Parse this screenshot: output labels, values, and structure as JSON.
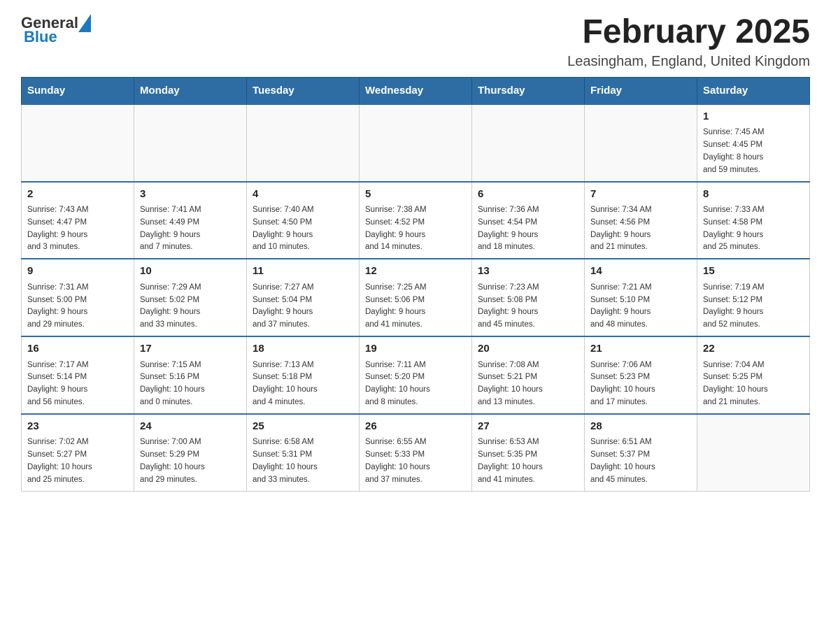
{
  "header": {
    "logo": {
      "general": "General",
      "blue": "Blue"
    },
    "title": "February 2025",
    "subtitle": "Leasingham, England, United Kingdom"
  },
  "calendar": {
    "days_of_week": [
      "Sunday",
      "Monday",
      "Tuesday",
      "Wednesday",
      "Thursday",
      "Friday",
      "Saturday"
    ],
    "weeks": [
      [
        {
          "day": "",
          "info": ""
        },
        {
          "day": "",
          "info": ""
        },
        {
          "day": "",
          "info": ""
        },
        {
          "day": "",
          "info": ""
        },
        {
          "day": "",
          "info": ""
        },
        {
          "day": "",
          "info": ""
        },
        {
          "day": "1",
          "info": "Sunrise: 7:45 AM\nSunset: 4:45 PM\nDaylight: 8 hours\nand 59 minutes."
        }
      ],
      [
        {
          "day": "2",
          "info": "Sunrise: 7:43 AM\nSunset: 4:47 PM\nDaylight: 9 hours\nand 3 minutes."
        },
        {
          "day": "3",
          "info": "Sunrise: 7:41 AM\nSunset: 4:49 PM\nDaylight: 9 hours\nand 7 minutes."
        },
        {
          "day": "4",
          "info": "Sunrise: 7:40 AM\nSunset: 4:50 PM\nDaylight: 9 hours\nand 10 minutes."
        },
        {
          "day": "5",
          "info": "Sunrise: 7:38 AM\nSunset: 4:52 PM\nDaylight: 9 hours\nand 14 minutes."
        },
        {
          "day": "6",
          "info": "Sunrise: 7:36 AM\nSunset: 4:54 PM\nDaylight: 9 hours\nand 18 minutes."
        },
        {
          "day": "7",
          "info": "Sunrise: 7:34 AM\nSunset: 4:56 PM\nDaylight: 9 hours\nand 21 minutes."
        },
        {
          "day": "8",
          "info": "Sunrise: 7:33 AM\nSunset: 4:58 PM\nDaylight: 9 hours\nand 25 minutes."
        }
      ],
      [
        {
          "day": "9",
          "info": "Sunrise: 7:31 AM\nSunset: 5:00 PM\nDaylight: 9 hours\nand 29 minutes."
        },
        {
          "day": "10",
          "info": "Sunrise: 7:29 AM\nSunset: 5:02 PM\nDaylight: 9 hours\nand 33 minutes."
        },
        {
          "day": "11",
          "info": "Sunrise: 7:27 AM\nSunset: 5:04 PM\nDaylight: 9 hours\nand 37 minutes."
        },
        {
          "day": "12",
          "info": "Sunrise: 7:25 AM\nSunset: 5:06 PM\nDaylight: 9 hours\nand 41 minutes."
        },
        {
          "day": "13",
          "info": "Sunrise: 7:23 AM\nSunset: 5:08 PM\nDaylight: 9 hours\nand 45 minutes."
        },
        {
          "day": "14",
          "info": "Sunrise: 7:21 AM\nSunset: 5:10 PM\nDaylight: 9 hours\nand 48 minutes."
        },
        {
          "day": "15",
          "info": "Sunrise: 7:19 AM\nSunset: 5:12 PM\nDaylight: 9 hours\nand 52 minutes."
        }
      ],
      [
        {
          "day": "16",
          "info": "Sunrise: 7:17 AM\nSunset: 5:14 PM\nDaylight: 9 hours\nand 56 minutes."
        },
        {
          "day": "17",
          "info": "Sunrise: 7:15 AM\nSunset: 5:16 PM\nDaylight: 10 hours\nand 0 minutes."
        },
        {
          "day": "18",
          "info": "Sunrise: 7:13 AM\nSunset: 5:18 PM\nDaylight: 10 hours\nand 4 minutes."
        },
        {
          "day": "19",
          "info": "Sunrise: 7:11 AM\nSunset: 5:20 PM\nDaylight: 10 hours\nand 8 minutes."
        },
        {
          "day": "20",
          "info": "Sunrise: 7:08 AM\nSunset: 5:21 PM\nDaylight: 10 hours\nand 13 minutes."
        },
        {
          "day": "21",
          "info": "Sunrise: 7:06 AM\nSunset: 5:23 PM\nDaylight: 10 hours\nand 17 minutes."
        },
        {
          "day": "22",
          "info": "Sunrise: 7:04 AM\nSunset: 5:25 PM\nDaylight: 10 hours\nand 21 minutes."
        }
      ],
      [
        {
          "day": "23",
          "info": "Sunrise: 7:02 AM\nSunset: 5:27 PM\nDaylight: 10 hours\nand 25 minutes."
        },
        {
          "day": "24",
          "info": "Sunrise: 7:00 AM\nSunset: 5:29 PM\nDaylight: 10 hours\nand 29 minutes."
        },
        {
          "day": "25",
          "info": "Sunrise: 6:58 AM\nSunset: 5:31 PM\nDaylight: 10 hours\nand 33 minutes."
        },
        {
          "day": "26",
          "info": "Sunrise: 6:55 AM\nSunset: 5:33 PM\nDaylight: 10 hours\nand 37 minutes."
        },
        {
          "day": "27",
          "info": "Sunrise: 6:53 AM\nSunset: 5:35 PM\nDaylight: 10 hours\nand 41 minutes."
        },
        {
          "day": "28",
          "info": "Sunrise: 6:51 AM\nSunset: 5:37 PM\nDaylight: 10 hours\nand 45 minutes."
        },
        {
          "day": "",
          "info": ""
        }
      ]
    ]
  }
}
